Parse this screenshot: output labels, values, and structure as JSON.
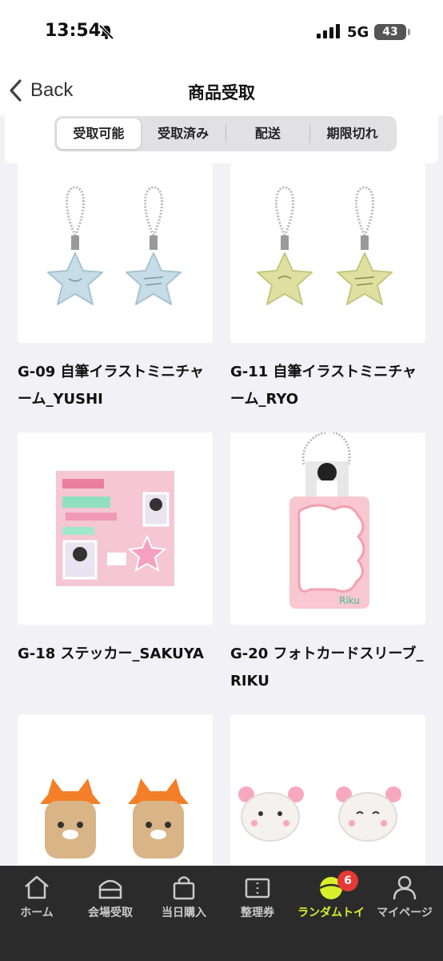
{
  "status_bar": {
    "time": "13:54",
    "network": "5G",
    "battery": "43"
  },
  "nav": {
    "back_label": "Back",
    "title": "商品受取"
  },
  "segments": [
    {
      "label": "受取可能",
      "active": true
    },
    {
      "label": "受取済み",
      "active": false
    },
    {
      "label": "配送",
      "active": false
    },
    {
      "label": "期限切れ",
      "active": false
    }
  ],
  "items": [
    {
      "name": "G-09 自筆イラストミニチャーム_YUSHI",
      "charm_color": "#c6dce6"
    },
    {
      "name": "G-11 自筆イラストミニチャーム_RYO",
      "charm_color": "#dfe0a0"
    },
    {
      "name": "G-18 ステッカー_SAKUYA"
    },
    {
      "name": "G-20 フォトカードスリーブ_RIKU"
    },
    {
      "name": ""
    },
    {
      "name": ""
    }
  ],
  "tabbar": [
    {
      "label": "ホーム",
      "icon": "home-icon"
    },
    {
      "label": "会場受取",
      "icon": "venue-icon"
    },
    {
      "label": "当日購入",
      "icon": "shopping-bag-icon"
    },
    {
      "label": "整理券",
      "icon": "ticket-icon"
    },
    {
      "label": "ランダムトイ",
      "icon": "random-toy-icon",
      "active": true,
      "badge": "6"
    },
    {
      "label": "マイページ",
      "icon": "person-icon"
    }
  ],
  "colors": {
    "accent": "#d8f02a",
    "badge": "#e53935",
    "tabbar_bg": "#2b2b2b",
    "background": "#f2f2f6"
  }
}
